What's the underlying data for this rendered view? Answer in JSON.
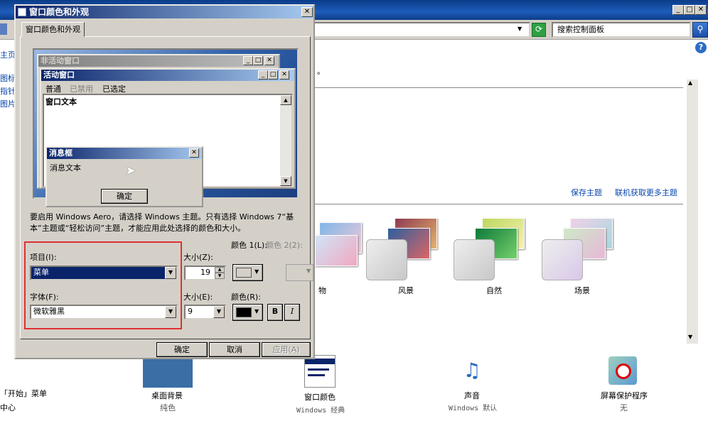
{
  "background": {
    "address_bar": {
      "search_placeholder": "搜索控制面板",
      "refresh_icon": "refresh-icon"
    },
    "left_nav": [
      "主页",
      "图标",
      "指针",
      "图片"
    ],
    "text_fragment": "。",
    "theme_links": {
      "save": "保存主题",
      "online": "联机获取更多主题"
    },
    "theme_captions": [
      "物",
      "风景",
      "自然",
      "场景"
    ],
    "bottom_items": [
      {
        "label": "桌面背景",
        "sub": "纯色"
      },
      {
        "label": "窗口颜色",
        "sub": "Windows 经典"
      },
      {
        "label": "声音",
        "sub": "Windows 默认"
      },
      {
        "label": "屏幕保护程序",
        "sub": "无"
      }
    ],
    "left_bottom": [
      "「开始」菜单",
      "中心"
    ],
    "help_icon": "?"
  },
  "dialog": {
    "title": "窗口颜色和外观",
    "tab": "窗口颜色和外观",
    "close_glyph": "✕",
    "preview": {
      "inactive_title": "非活动窗口",
      "active_title": "活动窗口",
      "menu": [
        "普通",
        "已禁用",
        "已选定"
      ],
      "window_text": "窗口文本",
      "msgbox_title": "消息框",
      "msgbox_text": "消息文本",
      "msgbox_ok": "确定"
    },
    "info_text": "要启用 Windows Aero，请选择 Windows 主题。只有选择 Windows 7“基本”主题或“轻松访问”主题，才能应用此处选择的颜色和大小。",
    "item_label": "项目(I):",
    "item_value": "菜单",
    "size_label": "大小(Z):",
    "size_value": "19",
    "color1_label": "颜色 1(L):",
    "color2_label": "颜色 2(2):",
    "font_label": "字体(F):",
    "font_value": "微软雅黑",
    "font_size_label": "大小(E):",
    "font_size_value": "9",
    "font_color_label": "颜色(R):",
    "bold_label": "B",
    "italic_label": "I",
    "ok": "确定",
    "cancel": "取消",
    "apply": "应用(A)",
    "colors": {
      "color1": "#d4d0c8",
      "font_color": "#000000",
      "highlight": "#0a246a",
      "red_box": "#e03030"
    }
  }
}
